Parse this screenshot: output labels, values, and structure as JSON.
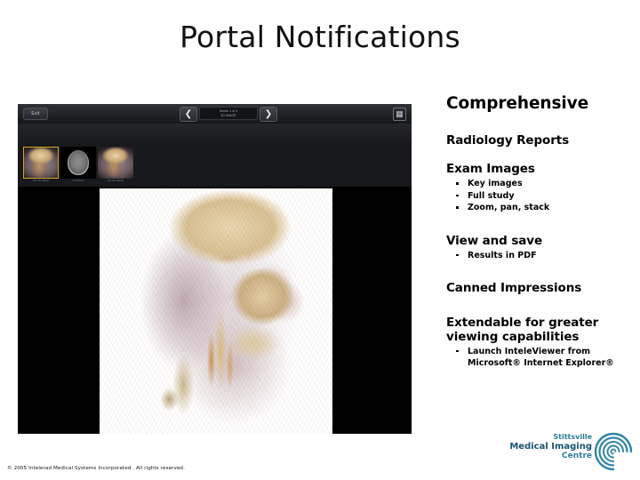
{
  "slide": {
    "title": "Portal Notifications",
    "footer": "© 2005 Intelerad Medical Systems Incorporated . All rights reserved."
  },
  "viewer": {
    "exit_button": "Exit",
    "thumbnails_button": "Thumbnails",
    "nav": {
      "prev_icon": "arrow-left-icon",
      "next_icon": "arrow-right-icon",
      "series_label": "Series 1 of 3",
      "series_sublabel": "3D IMAGE"
    },
    "tools": [
      {
        "name": "layout-tool",
        "icon": "layout-icon"
      },
      {
        "name": "window-level-tool",
        "icon": "brightness-icon"
      },
      {
        "name": "pan-tool",
        "icon": "hand-icon"
      },
      {
        "name": "zoom-tool",
        "icon": "magnifier-icon"
      }
    ],
    "right_icons": [
      {
        "name": "series-info-button",
        "icon": "panel-icon"
      },
      {
        "name": "reset-button",
        "icon": "refresh-icon"
      }
    ],
    "thumbnails": [
      {
        "name": "thumbnail-3d-volume-1",
        "caption": "3D VR HEAD",
        "type": "volume",
        "selected": true
      },
      {
        "name": "thumbnail-axial-ct",
        "caption": "CT AXIAL",
        "type": "ct",
        "selected": false
      },
      {
        "name": "thumbnail-3d-volume-2",
        "caption": "3D VR NECK",
        "type": "volume",
        "selected": false
      }
    ],
    "main_image_alt": "3D volume rendered CT angiogram of head and neck"
  },
  "content": {
    "heading_comprehensive": "Comprehensive",
    "heading_radiology_reports": "Radiology Reports",
    "heading_exam_images": "Exam Images",
    "exam_images_bullets": [
      "Key images",
      "Full study",
      "Zoom, pan, stack"
    ],
    "heading_view_and_save": "View and save",
    "view_and_save_bullets": [
      "Results in PDF"
    ],
    "heading_canned_impressions": "Canned Impressions",
    "heading_extendable_line1": "Extendable for greater",
    "heading_extendable_line2": "viewing capabilities",
    "extendable_bullets": [
      "Launch InteleViewer from Microsoft® Internet Explorer®"
    ]
  },
  "logo": {
    "line1": "Stittsville",
    "line2": "Medical Imaging",
    "line3": "Centre",
    "mark": "concentric-arcs-icon",
    "color": "#1d6b8c"
  }
}
